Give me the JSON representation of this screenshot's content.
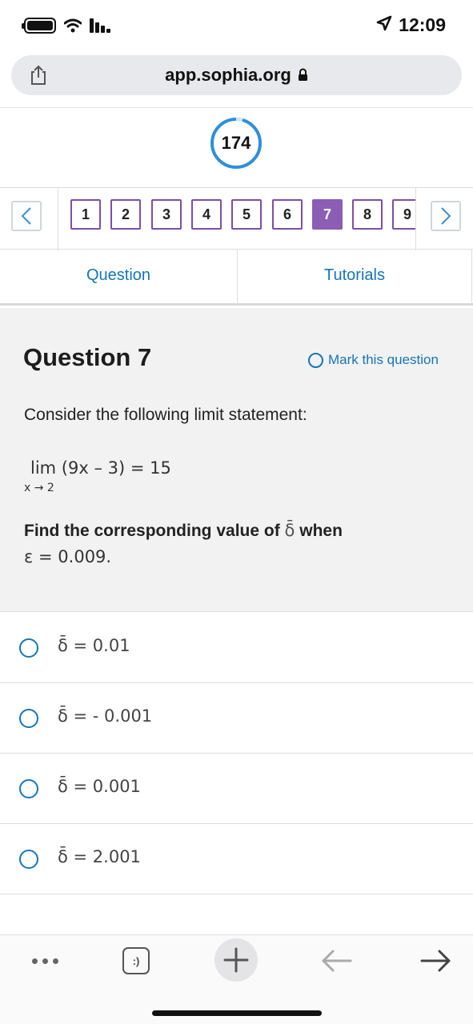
{
  "status_bar": {
    "time": "12:09",
    "icons": [
      "battery-icon",
      "wifi-icon",
      "signal-icon",
      "location-arrow-icon"
    ]
  },
  "browser": {
    "url": "app.sophia.org",
    "icons": [
      "share-icon",
      "lock-icon"
    ]
  },
  "score": {
    "value": "174",
    "ring_color": "#2f8fd8"
  },
  "pager": {
    "pages": [
      "1",
      "2",
      "3",
      "4",
      "5",
      "6",
      "7",
      "8",
      "9"
    ],
    "active_page": "7",
    "accent": "#8b5db5",
    "icons": [
      "chevron-left-icon",
      "chevron-right-icon"
    ]
  },
  "tabs": {
    "question": "Question",
    "tutorials": "Tutorials",
    "color": "#1675b8"
  },
  "question": {
    "title": "Question 7",
    "mark_label": "Mark this question",
    "prompt": "Consider the following limit statement:",
    "limit_expression": "lim (9x – 3) = 15",
    "limit_subscript": "x → 2",
    "find_text": "Find the corresponding value of",
    "find_symbol": "δ̄",
    "find_when": "when",
    "epsilon_line": "ε = 0.009."
  },
  "options": [
    {
      "text": "δ̄ = 0.01"
    },
    {
      "text": "δ̄ =  - 0.001"
    },
    {
      "text": "δ̄ = 0.001"
    },
    {
      "text": "δ̄ = 2.001"
    }
  ],
  "toolbar": {
    "tabs_icon_label": ":)",
    "icons": [
      "more-icon",
      "tabs-icon",
      "plus-icon",
      "back-arrow-icon",
      "forward-arrow-icon"
    ]
  }
}
